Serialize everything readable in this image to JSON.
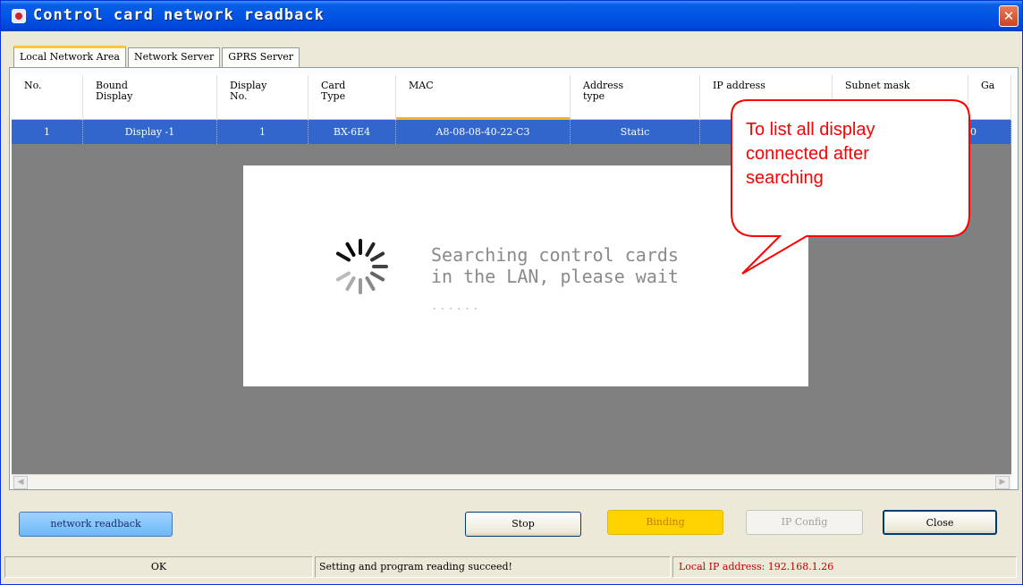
{
  "window": {
    "title": "Control card network readback",
    "close_glyph": "✕"
  },
  "tabs": [
    {
      "label": "Local Network Area",
      "active": true
    },
    {
      "label": "Network Server",
      "active": false
    },
    {
      "label": "GPRS Server",
      "active": false
    }
  ],
  "table": {
    "columns": [
      "No.",
      "Bound\nDisplay",
      "Display\nNo.",
      "Card\nType",
      "MAC",
      "Address\ntype",
      "IP address",
      "Subnet mask",
      "Ga"
    ],
    "rows": [
      [
        "1",
        "Display -1",
        "1",
        "BX-6E4",
        "A8-08-08-40-22-C3",
        "Static",
        "",
        "",
        "0"
      ]
    ]
  },
  "loader": {
    "message": "Searching control cards\nin the LAN, please wait",
    "dots": "......"
  },
  "callout": {
    "text": "To list all display\nconnected after\nsearching",
    "color": "#ff0000"
  },
  "buttons": {
    "readback": "network readback",
    "stop": "Stop",
    "binding": "Binding",
    "ip_config": "IP Config",
    "close": "Close"
  },
  "statusbar": {
    "state": "OK",
    "message": "Setting and program reading succeed!",
    "local_ip": "Local IP address: 192.168.1.26"
  },
  "scrollbar": {
    "left_glyph": "◀",
    "right_glyph": "▶"
  }
}
